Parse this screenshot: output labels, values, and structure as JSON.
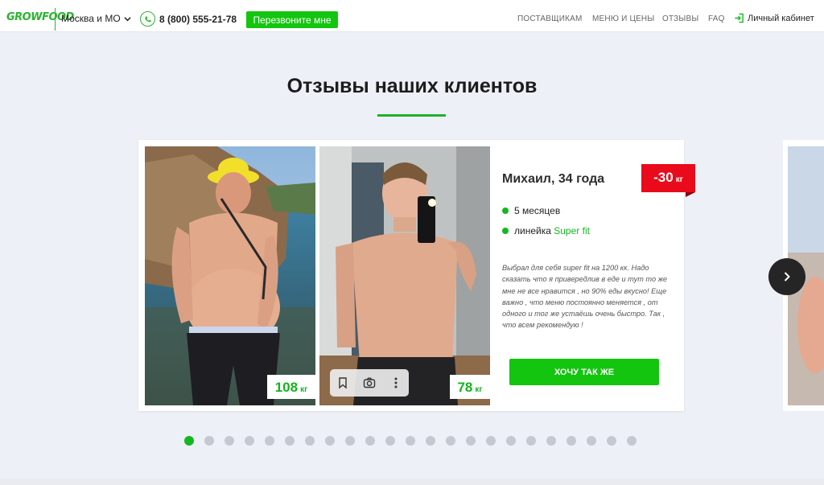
{
  "header": {
    "logo": "GROWFOOD",
    "region": "Москва и МО",
    "phone": "8 (800) 555-21-78",
    "callback_label": "Перезвоните мне",
    "nav": [
      "ПОСТАВЩИКАМ",
      "МЕНЮ И ЦЕНЫ",
      "ОТЗЫВЫ",
      "FAQ"
    ],
    "cabinet": "Личный кабинет"
  },
  "section": {
    "title": "Отзывы наших клиентов"
  },
  "review": {
    "name": "Михаил, 34 года",
    "badge_value": "-30",
    "badge_unit": "кг",
    "duration": "5 месяцев",
    "line_prefix": "линейка",
    "line_name": "Super fit",
    "quote": "Выбрал для себя super fit на 1200 кк. Надо сказать что я привередлив в еде и тут то же мне не все нравится , но 90% еды вкусно! Еще важно , что меню постоянно меняется , от одного и тог же устаёшь очень быстро. Так , что всем рекомендую !",
    "before_weight": "108",
    "after_weight": "78",
    "weight_unit": "кг",
    "cta_label": "ХОЧУ ТАК ЖЕ"
  },
  "pagination": {
    "total": 23,
    "active_index": 0
  },
  "colors": {
    "brand_green": "#14c50f",
    "badge_red": "#e90a1b",
    "dot_inactive": "#c4c9d1"
  },
  "icons": [
    "chevron-down-icon",
    "phone-icon",
    "login-icon",
    "bookmark-icon",
    "camera-icon",
    "more-icon",
    "arrow-right-icon"
  ]
}
